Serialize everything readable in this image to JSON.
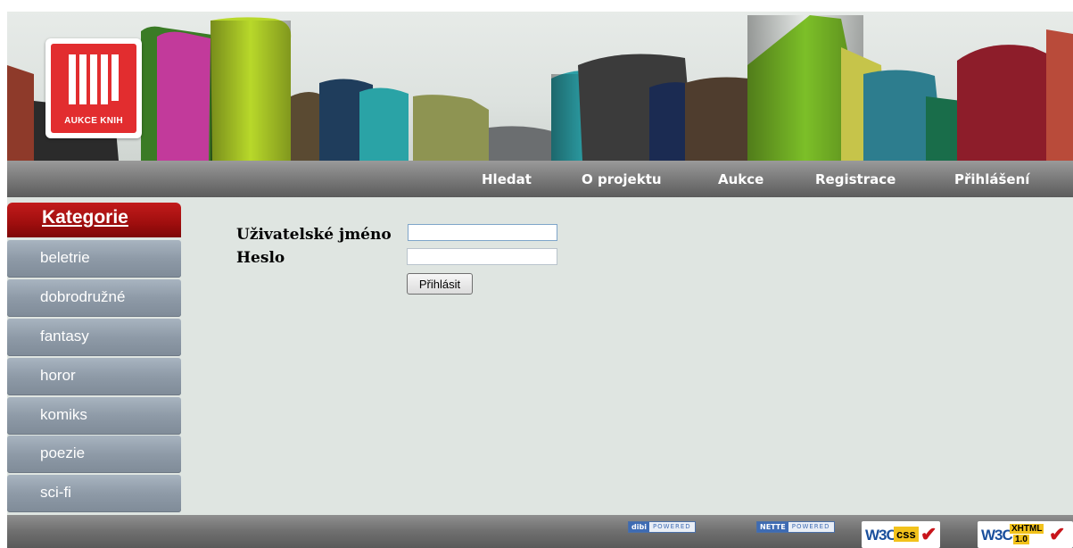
{
  "logo": {
    "text": "AUKCE KNIH"
  },
  "nav": {
    "items": [
      {
        "label": "Hledat"
      },
      {
        "label": "O projektu"
      },
      {
        "label": "Aukce"
      },
      {
        "label": "Registrace"
      },
      {
        "label": "Přihlášení"
      }
    ]
  },
  "sidebar": {
    "title": "Kategorie",
    "items": [
      {
        "label": "beletrie"
      },
      {
        "label": "dobrodružné"
      },
      {
        "label": "fantasy"
      },
      {
        "label": "horor"
      },
      {
        "label": "komiks"
      },
      {
        "label": "poezie"
      },
      {
        "label": "sci-fi"
      }
    ]
  },
  "login": {
    "username_label": "Uživatelské jméno",
    "username_value": "",
    "password_label": "Heslo",
    "password_value": "",
    "submit_label": "Přihlásit"
  },
  "footer": {
    "badges": [
      {
        "brand": "dibi",
        "text": "POWERED"
      },
      {
        "brand": "NETTE",
        "text": "POWERED"
      }
    ],
    "w3c_css": {
      "w3c": "W3C",
      "label": "css"
    },
    "w3c_xhtml": {
      "w3c": "W3C",
      "label": "XHTML",
      "version": "1.0"
    }
  },
  "colors": {
    "nav_bg": "#6e6e6e",
    "sidebar_active": "#b01515",
    "sidebar_item": "#93a0ad",
    "content_bg": "#dfe5e1",
    "logo_red": "#e22d2f"
  }
}
